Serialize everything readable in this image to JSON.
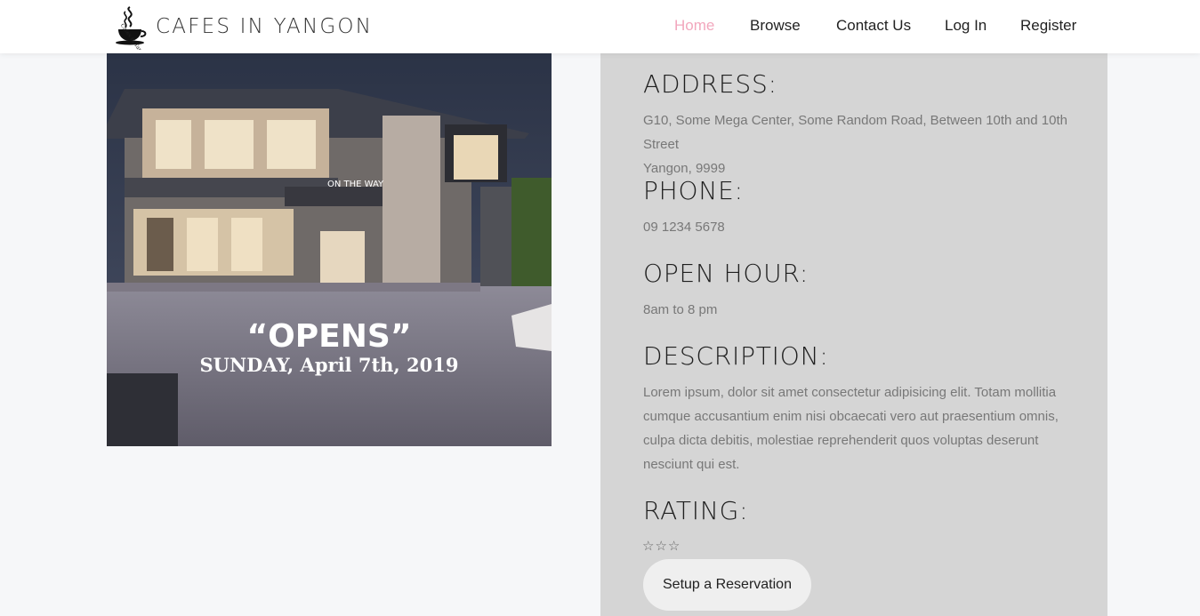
{
  "header": {
    "brand_title": "CAFES IN YANGON",
    "logo_text": "Cafes in Yangon",
    "nav": [
      {
        "label": "Home",
        "active": true
      },
      {
        "label": "Browse",
        "active": false
      },
      {
        "label": "Contact Us",
        "active": false
      },
      {
        "label": "Log In",
        "active": false
      },
      {
        "label": "Register",
        "active": false
      }
    ]
  },
  "hero": {
    "sign_text": "ON THE WAY",
    "banner_line1": "“OPENS”",
    "banner_line2": "SUNDAY, April 7th, 2019"
  },
  "details": {
    "address_heading": "ADDRESS:",
    "address_line1": "G10, Some Mega Center, Some Random Road, Between 10th and 10th Street",
    "address_line2": "Yangon, 9999",
    "phone_heading": "PHONE:",
    "phone": "09 1234 5678",
    "hours_heading": "OPEN HOUR:",
    "hours": "8am to 8 pm",
    "description_heading": "DESCRIPTION:",
    "description": "Lorem ipsum, dolor sit amet consectetur adipisicing elit. Totam mollitia cumque accusantium enim nisi obcaecati vero aut praesentium omnis, culpa dicta debitis, molestiae reprehenderit quos voluptas deserunt nesciunt qui est.",
    "rating_heading": "RATING:",
    "rating_stars": [
      "☆",
      "☆",
      "☆"
    ],
    "rating_value": 0,
    "rating_max": 3,
    "reservation_button": "Setup a Reservation"
  },
  "colors": {
    "accent_active_nav": "#f2a7bd",
    "panel_bg": "#d5d5d5",
    "page_bg": "#f6f7f9",
    "button_bg": "#efefef"
  },
  "icons": [
    "coffee-cup-logo-icon",
    "star-outline-icon"
  ]
}
